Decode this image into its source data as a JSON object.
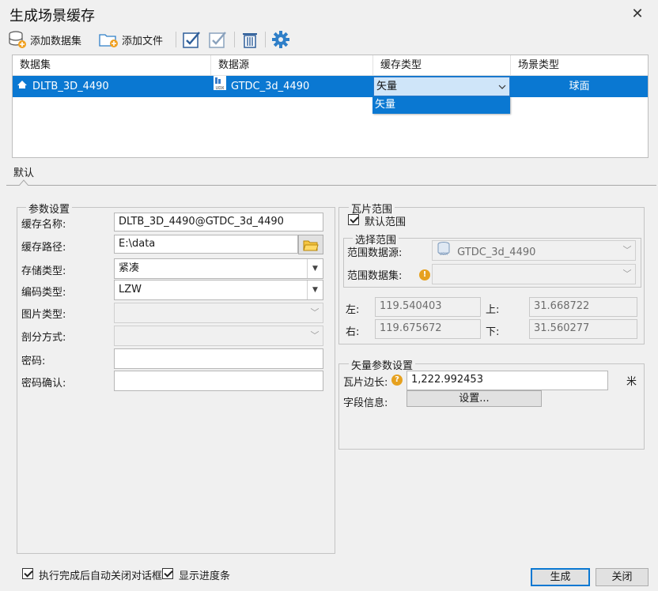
{
  "window": {
    "title": "生成场景缓存",
    "close_glyph": "✕"
  },
  "toolbar": {
    "add_dataset": "添加数据集",
    "add_file": "添加文件",
    "icons": [
      "database-add-icon",
      "folder-add-icon",
      "check-all-icon",
      "uncheck-icon",
      "delete-icon",
      "settings-icon"
    ]
  },
  "table": {
    "columns": [
      "数据集",
      "数据源",
      "缓存类型",
      "场景类型"
    ],
    "rows": [
      {
        "dataset": "DLTB_3D_4490",
        "datasource": "GTDC_3d_4490",
        "cache_type": "矢量",
        "scene_type": "球面"
      }
    ],
    "cache_type_options": [
      "矢量"
    ]
  },
  "tab": {
    "label": "默认"
  },
  "params": {
    "title": "参数设置",
    "cache_name_label": "缓存名称:",
    "cache_name": "DLTB_3D_4490@GTDC_3d_4490",
    "cache_path_label": "缓存路径:",
    "cache_path": "E:\\data",
    "storage_type_label": "存储类型:",
    "storage_type": "紧凑",
    "encoding_label": "编码类型:",
    "encoding": "LZW",
    "image_type_label": "图片类型:",
    "image_type": "",
    "split_label": "剖分方式:",
    "split": "",
    "password_label": "密码:",
    "password": "",
    "password_confirm_label": "密码确认:",
    "password_confirm": ""
  },
  "tile_range": {
    "title": "瓦片范围",
    "default_range_label": "默认范围",
    "default_range_checked": true,
    "select_title": "选择范围",
    "range_datasource_label": "范围数据源:",
    "range_datasource": "GTDC_3d_4490",
    "range_dataset_label": "范围数据集:",
    "range_dataset": "",
    "left_label": "左:",
    "left": "119.540403",
    "top_label": "上:",
    "top": "31.668722",
    "right_label": "右:",
    "right": "119.675672",
    "bottom_label": "下:",
    "bottom": "31.560277"
  },
  "vector": {
    "title": "矢量参数设置",
    "tile_size_label": "瓦片边长:",
    "tile_size": "1,222.992453",
    "unit": "米",
    "field_info_label": "字段信息:",
    "field_info_button": "设置..."
  },
  "footer": {
    "auto_close_label": "执行完成后自动关闭对话框",
    "auto_close_checked": true,
    "show_progress_label": "显示进度条",
    "show_progress_checked": true,
    "generate": "生成",
    "close": "关闭"
  },
  "colors": {
    "selection": "#0a78d2",
    "window_bg": "#f0f0f0"
  }
}
